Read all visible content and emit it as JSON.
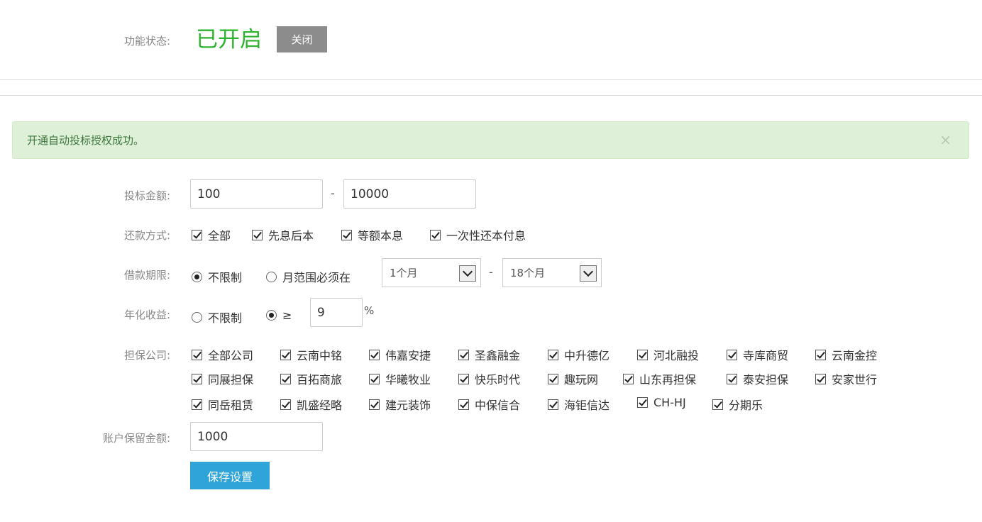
{
  "top": {
    "status_label": "功能状态:",
    "status_value": "已开启",
    "close_button": "关闭",
    "status_color": "#2db32d"
  },
  "alert": {
    "message": "开通自动投标授权成功。",
    "close": "×"
  },
  "form": {
    "amount": {
      "label": "投标金额:",
      "min": "100",
      "max": "10000",
      "separator": "-"
    },
    "repay": {
      "label": "还款方式:",
      "options": [
        "全部",
        "先息后本",
        "等额本息",
        "一次性还本付息"
      ]
    },
    "term": {
      "label": "借款期限:",
      "unlimited": "不限制",
      "range": "月范围必须在",
      "from": "1个月",
      "to": "18个月",
      "separator": "-"
    },
    "yield": {
      "label": "年化收益:",
      "unlimited": "不限制",
      "ge": "≥",
      "value": "9",
      "unit": "%"
    },
    "guarantor": {
      "label": "担保公司:",
      "row1": [
        "全部公司",
        "云南中铭",
        "伟嘉安捷",
        "圣鑫融金",
        "中升德亿",
        "河北融投",
        "寺库商贸",
        "云南金控"
      ],
      "row2": [
        "同展担保",
        "百拓商旅",
        "华曦牧业",
        "快乐时代",
        "趣玩网",
        "山东再担保",
        "泰安担保",
        "安家世行"
      ],
      "row3": [
        "同岳租赁",
        "凯盛经略",
        "建元装饰",
        "中保信合",
        "海钜信达",
        "CH-HJ",
        "分期乐"
      ]
    },
    "reserve": {
      "label": "账户保留金额:",
      "value": "1000"
    },
    "save_button": "保存设置"
  }
}
